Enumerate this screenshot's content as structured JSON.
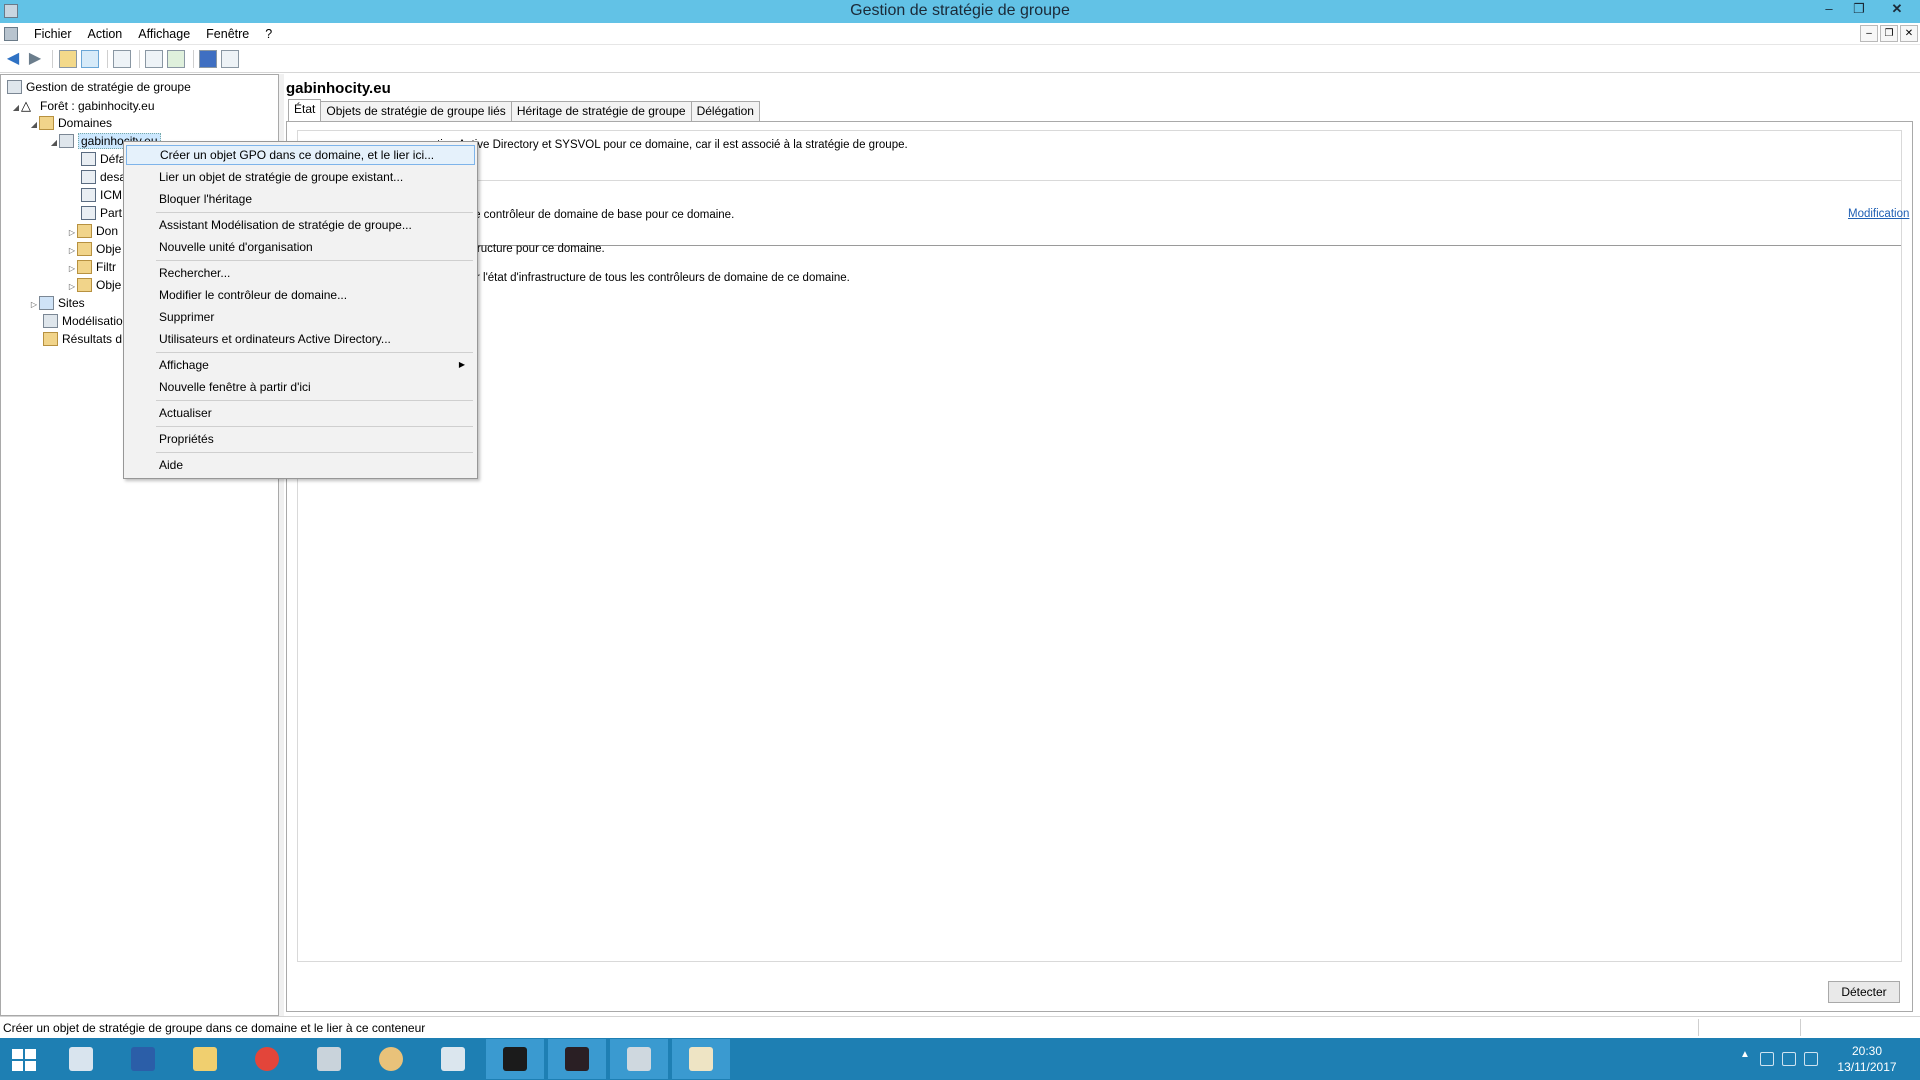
{
  "window": {
    "title": "Gestion de stratégie de groupe"
  },
  "menubar": {
    "items": [
      "Fichier",
      "Action",
      "Affichage",
      "Fenêtre",
      "?"
    ]
  },
  "window_controls": {
    "minimize": "–",
    "restore": "❐",
    "close": "✕"
  },
  "tree": {
    "nodes": [
      "Gestion de stratégie de groupe",
      "Forêt : gabinhocity.eu",
      "Domaines",
      "gabinhocity.eu",
      "Défa",
      "desa",
      "ICM",
      "Part",
      "Don",
      "Obje",
      "Filtr",
      "Obje",
      "Sites",
      "Modélisatio",
      "Résultats d"
    ]
  },
  "right_pane": {
    "title": "gabinhocity.eu",
    "tabs": [
      "État",
      "Objets de stratégie de groupe liés",
      "Héritage de stratégie de groupe",
      "Délégation"
    ],
    "texts": [
      "tion Active Directory et SYSVOL pour ce domaine, car il est associé à la stratégie de groupe.",
      "eu est le contrôleur de domaine de base pour ce domaine.",
      "d'infrastructure pour ce domaine.",
      "collecter l'état d'infrastructure de tous les contrôleurs de domaine de ce domaine."
    ],
    "modification_link": "Modification",
    "detect_button": "Détecter"
  },
  "context_menu": {
    "items": [
      "Créer un objet GPO dans ce domaine, et le lier ici...",
      "Lier un objet de stratégie de groupe existant...",
      "Bloquer l'héritage",
      "Assistant Modélisation de stratégie de groupe...",
      "Nouvelle unité d'organisation",
      "Rechercher...",
      "Modifier le contrôleur de domaine...",
      "Supprimer",
      "Utilisateurs et ordinateurs Active Directory...",
      "Affichage",
      "Nouvelle fenêtre à partir d'ici",
      "Actualiser",
      "Propriétés",
      "Aide"
    ]
  },
  "statusbar": {
    "text": "Créer un objet de stratégie de groupe dans ce domaine et le lier à ce conteneur"
  },
  "taskbar": {
    "time": "20:30",
    "date": "13/11/2017",
    "colors": {
      "bar": "#1e7fb3",
      "active": "#3a9ad0"
    }
  }
}
